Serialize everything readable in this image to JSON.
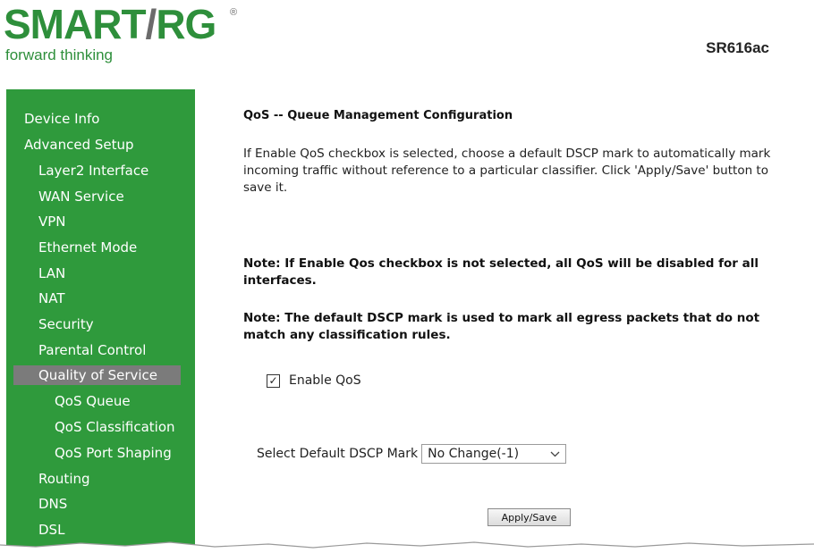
{
  "brand": {
    "logo": "SMART/RG",
    "registered": "®",
    "tagline": "forward thinking",
    "model": "SR616ac",
    "colors": {
      "logo_main": "#2e8f3b",
      "logo_slash": "#6b6b6b",
      "sidebar_bg": "#2f9a3c",
      "active_bg": "#7b7b7b"
    }
  },
  "sidebar": {
    "items": [
      {
        "label": "Device Info",
        "level": 0
      },
      {
        "label": "Advanced Setup",
        "level": 0
      },
      {
        "label": "Layer2 Interface",
        "level": 1
      },
      {
        "label": "WAN Service",
        "level": 1
      },
      {
        "label": "VPN",
        "level": 1
      },
      {
        "label": "Ethernet Mode",
        "level": 1
      },
      {
        "label": "LAN",
        "level": 1
      },
      {
        "label": "NAT",
        "level": 1
      },
      {
        "label": "Security",
        "level": 1
      },
      {
        "label": "Parental Control",
        "level": 1
      },
      {
        "label": "Quality of Service",
        "level": 1,
        "active": true
      },
      {
        "label": "QoS Queue",
        "level": 2
      },
      {
        "label": "QoS Classification",
        "level": 2
      },
      {
        "label": "QoS Port Shaping",
        "level": 2
      },
      {
        "label": "Routing",
        "level": 1
      },
      {
        "label": "DNS",
        "level": 1
      },
      {
        "label": "DSL",
        "level": 1
      }
    ]
  },
  "main": {
    "title": "QoS -- Queue Management Configuration",
    "description": "If Enable QoS checkbox is selected, choose a default DSCP mark to automatically mark incoming traffic without reference to a particular classifier. Click 'Apply/Save' button to save it.",
    "note1": "Note: If Enable Qos checkbox is not selected, all QoS will be disabled for all interfaces.",
    "note2": "Note: The default DSCP mark is used to mark all egress packets that do not match any classification rules.",
    "enable_qos": {
      "label": "Enable QoS",
      "checked": true,
      "check_glyph": "✓"
    },
    "dscp": {
      "label": "Select Default DSCP Mark",
      "value": "No Change(-1)"
    },
    "apply_label": "Apply/Save"
  }
}
